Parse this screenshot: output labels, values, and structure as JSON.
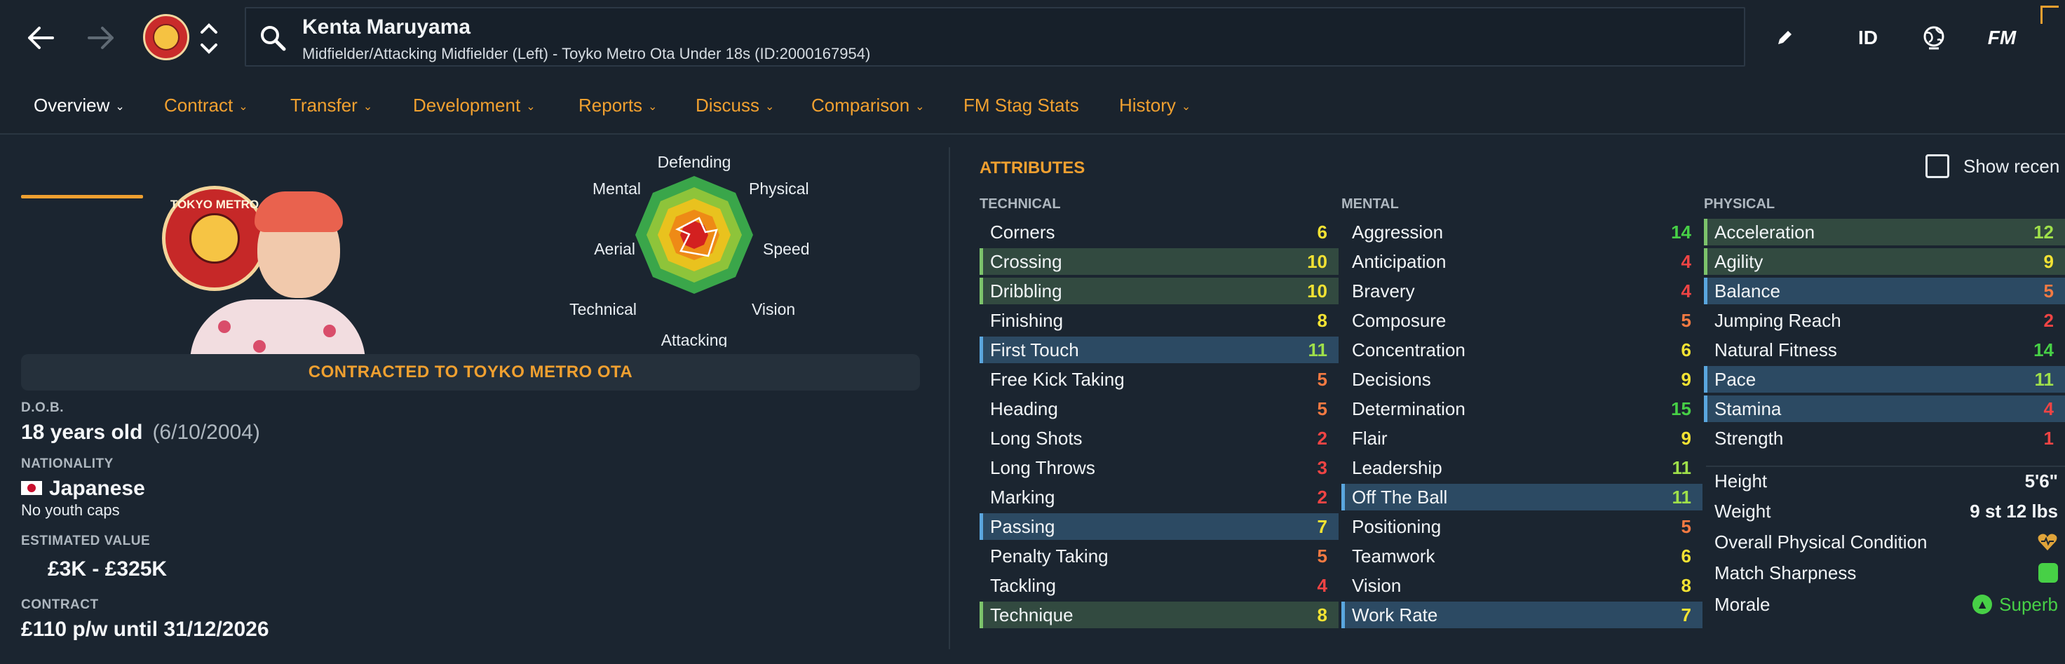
{
  "header": {
    "player_name": "Kenta Maruyama",
    "player_subtitle": "Midfielder/Attacking Midfielder (Left) - Toyko Metro Ota Under 18s (ID:2000167954)",
    "tools": {
      "id_label": "ID",
      "fm_label": "FM"
    },
    "icons": [
      "back-arrow-icon",
      "forward-arrow-icon",
      "club-badge",
      "chevron-up-icon",
      "chevron-down-icon",
      "search-icon",
      "pencil-icon",
      "globe-icon"
    ]
  },
  "tabs": [
    {
      "label": "Overview"
    },
    {
      "label": "Contract"
    },
    {
      "label": "Transfer"
    },
    {
      "label": "Development"
    },
    {
      "label": "Reports"
    },
    {
      "label": "Discuss"
    },
    {
      "label": "Comparison"
    },
    {
      "label": "FM Stag Stats"
    },
    {
      "label": "History"
    }
  ],
  "radar": {
    "labels": {
      "defending": "Defending",
      "physical": "Physical",
      "speed": "Speed",
      "vision": "Vision",
      "attacking": "Attacking",
      "technical": "Technical",
      "aerial": "Aerial",
      "mental": "Mental"
    }
  },
  "profile": {
    "photo_logo_text": "TOKYO METRO",
    "contract_banner": "CONTRACTED TO TOYKO METRO OTA",
    "dob_label": "D.O.B.",
    "age": "18 years old",
    "dob": "(6/10/2004)",
    "nationality_label": "NATIONALITY",
    "nationality": "Japanese",
    "youth_caps": "No youth caps",
    "value_label": "ESTIMATED VALUE",
    "value": "£3K - £325K",
    "contract_label": "CONTRACT",
    "contract": "£110 p/w until 31/12/2026"
  },
  "attributes": {
    "title": "ATTRIBUTES",
    "show_recent_label": "Show recen",
    "technical": {
      "heading": "TECHNICAL",
      "rows": [
        {
          "name": "Corners",
          "value": "6"
        },
        {
          "name": "Crossing",
          "value": "10"
        },
        {
          "name": "Dribbling",
          "value": "10"
        },
        {
          "name": "Finishing",
          "value": "8"
        },
        {
          "name": "First Touch",
          "value": "11"
        },
        {
          "name": "Free Kick Taking",
          "value": "5"
        },
        {
          "name": "Heading",
          "value": "5"
        },
        {
          "name": "Long Shots",
          "value": "2"
        },
        {
          "name": "Long Throws",
          "value": "3"
        },
        {
          "name": "Marking",
          "value": "2"
        },
        {
          "name": "Passing",
          "value": "7"
        },
        {
          "name": "Penalty Taking",
          "value": "5"
        },
        {
          "name": "Tackling",
          "value": "4"
        },
        {
          "name": "Technique",
          "value": "8"
        }
      ]
    },
    "mental": {
      "heading": "MENTAL",
      "rows": [
        {
          "name": "Aggression",
          "value": "14"
        },
        {
          "name": "Anticipation",
          "value": "4"
        },
        {
          "name": "Bravery",
          "value": "4"
        },
        {
          "name": "Composure",
          "value": "5"
        },
        {
          "name": "Concentration",
          "value": "6"
        },
        {
          "name": "Decisions",
          "value": "9"
        },
        {
          "name": "Determination",
          "value": "15"
        },
        {
          "name": "Flair",
          "value": "9"
        },
        {
          "name": "Leadership",
          "value": "11"
        },
        {
          "name": "Off The Ball",
          "value": "11"
        },
        {
          "name": "Positioning",
          "value": "5"
        },
        {
          "name": "Teamwork",
          "value": "6"
        },
        {
          "name": "Vision",
          "value": "8"
        },
        {
          "name": "Work Rate",
          "value": "7"
        }
      ]
    },
    "physical": {
      "heading": "PHYSICAL",
      "rows": [
        {
          "name": "Acceleration",
          "value": "12"
        },
        {
          "name": "Agility",
          "value": "9"
        },
        {
          "name": "Balance",
          "value": "5"
        },
        {
          "name": "Jumping Reach",
          "value": "2"
        },
        {
          "name": "Natural Fitness",
          "value": "14"
        },
        {
          "name": "Pace",
          "value": "11"
        },
        {
          "name": "Stamina",
          "value": "4"
        },
        {
          "name": "Strength",
          "value": "1"
        }
      ]
    },
    "extras": {
      "height_label": "Height",
      "height": "5'6\"",
      "weight_label": "Weight",
      "weight": "9 st 12 lbs",
      "condition_label": "Overall Physical Condition",
      "sharpness_label": "Match Sharpness",
      "morale_label": "Morale",
      "morale": "Superb"
    }
  },
  "colors": {
    "accent": "#f0a030",
    "background": "#1b2530",
    "value_low": "#ef4444",
    "value_lowmid": "#f47a42",
    "value_mid": "#f2e233",
    "value_high": "#47d046"
  }
}
